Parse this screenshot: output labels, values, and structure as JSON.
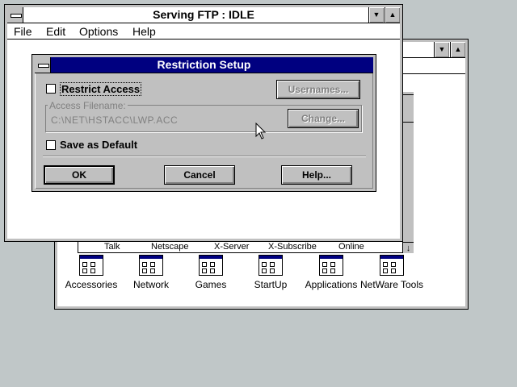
{
  "background_window": {
    "icons": [
      {
        "label": "Accessories"
      },
      {
        "label": "Network"
      },
      {
        "label": "Games"
      },
      {
        "label": "StartUp"
      },
      {
        "label": "Applications"
      },
      {
        "label": "NetWare Tools"
      }
    ],
    "partial_labels": [
      "Talk",
      "Netscape",
      "X-Server",
      "X-Subscribe",
      "Online"
    ]
  },
  "ftp_window": {
    "title": "Serving FTP : IDLE",
    "menu": [
      "File",
      "Edit",
      "Options",
      "Help"
    ]
  },
  "dialog": {
    "title": "Restriction Setup",
    "restrict_access_label": "Restrict Access",
    "restrict_access_checked": false,
    "usernames_button": "Usernames...",
    "access_filename_caption": "Access Filename:",
    "access_filename_value": "C:\\NET\\HSTACC\\LWP.ACC",
    "change_button": "Change...",
    "save_default_label": "Save as Default",
    "save_default_checked": false,
    "ok_button": "OK",
    "cancel_button": "Cancel",
    "help_button": "Help..."
  },
  "colors": {
    "desktop": "#c0c7c8",
    "active_title": "#000080",
    "face": "#c0c0c0"
  }
}
